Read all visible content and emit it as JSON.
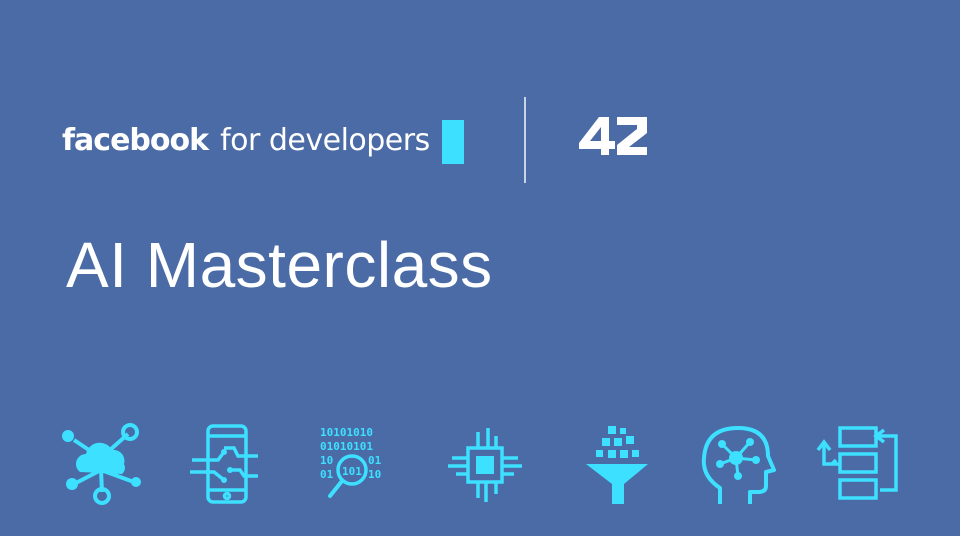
{
  "header": {
    "facebook_wordmark": "facebook",
    "facebook_tagline": "for developers",
    "partner_logo_text": "42"
  },
  "title": "AI Masterclass",
  "colors": {
    "background": "#4a6ba6",
    "accent": "#3ee0ff",
    "text": "#ffffff"
  },
  "icons": [
    "cloud-network-icon",
    "mobile-circuit-icon",
    "binary-search-icon",
    "chip-icon",
    "data-funnel-icon",
    "head-network-icon",
    "workflow-icon"
  ]
}
